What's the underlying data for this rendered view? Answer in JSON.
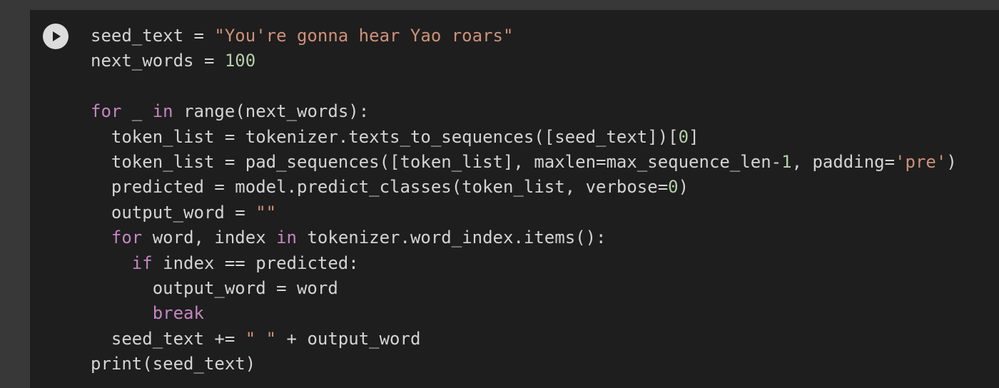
{
  "cell": {
    "run_button_label": "Run cell",
    "code_lines": [
      [
        {
          "t": "seed_text = "
        },
        {
          "t": "\"You're gonna hear Yao roars\"",
          "k": "str"
        }
      ],
      [
        {
          "t": "next_words = "
        },
        {
          "t": "100",
          "k": "num"
        }
      ],
      [],
      [
        {
          "t": "for",
          "k": "kw"
        },
        {
          "t": " _ "
        },
        {
          "t": "in",
          "k": "kw"
        },
        {
          "t": " range(next_words):"
        }
      ],
      [
        {
          "t": "  token_list = tokenizer.texts_to_sequences([seed_text])["
        },
        {
          "t": "0",
          "k": "num"
        },
        {
          "t": "]"
        }
      ],
      [
        {
          "t": "  token_list = pad_sequences([token_list], maxlen=max_sequence_len-"
        },
        {
          "t": "1",
          "k": "num"
        },
        {
          "t": ", padding="
        },
        {
          "t": "'pre'",
          "k": "str"
        },
        {
          "t": ")"
        }
      ],
      [
        {
          "t": "  predicted = model.predict_classes(token_list, verbose="
        },
        {
          "t": "0",
          "k": "num"
        },
        {
          "t": ")"
        }
      ],
      [
        {
          "t": "  output_word = "
        },
        {
          "t": "\"\"",
          "k": "str"
        }
      ],
      [
        {
          "t": "  "
        },
        {
          "t": "for",
          "k": "kw"
        },
        {
          "t": " word, index "
        },
        {
          "t": "in",
          "k": "kw"
        },
        {
          "t": " tokenizer.word_index.items():"
        }
      ],
      [
        {
          "t": "    "
        },
        {
          "t": "if",
          "k": "kw"
        },
        {
          "t": " index == predicted:"
        }
      ],
      [
        {
          "t": "      output_word = word"
        }
      ],
      [
        {
          "t": "      "
        },
        {
          "t": "break",
          "k": "kw"
        }
      ],
      [
        {
          "t": "  seed_text += "
        },
        {
          "t": "\" \"",
          "k": "str"
        },
        {
          "t": " + output_word"
        }
      ],
      [
        {
          "t": "print(seed_text)"
        }
      ]
    ]
  },
  "colors": {
    "background": "#383838",
    "cell_background": "#1e1e1e",
    "default_text": "#d4d4d4",
    "string": "#ce9178",
    "number": "#b5cea8",
    "keyword": "#c586c0"
  },
  "icons": {
    "run": "play-icon"
  }
}
